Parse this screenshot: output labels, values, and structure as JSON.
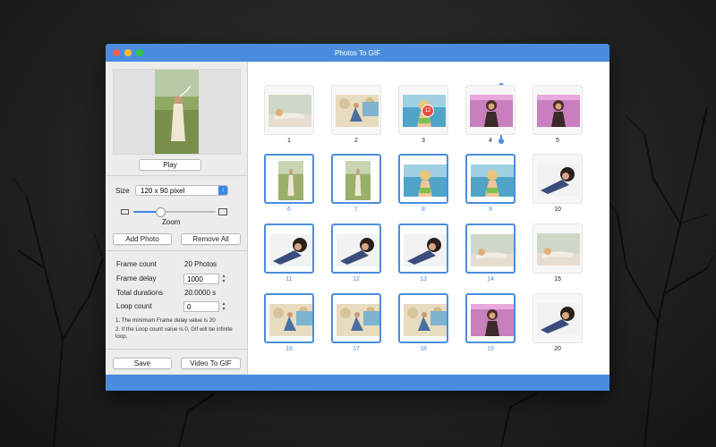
{
  "window": {
    "title": "Photos To GIF"
  },
  "sidebar": {
    "play_label": "Play",
    "size_label": "Size",
    "size_value": "120 x 90 pixel",
    "zoom_label": "Zoom",
    "zoom_level": 0.32,
    "add_label": "Add Photo",
    "remove_label": "Remove All",
    "frame_count_label": "Frame count",
    "frame_count_value": "20 Photos",
    "frame_delay_label": "Frame delay",
    "frame_delay_value": "1000",
    "total_label": "Total durations",
    "total_value": "20.0000 s",
    "loop_label": "Loop count",
    "loop_value": "0",
    "note1": "1. The minimum Frame delay value is 20",
    "note2": "2. If the Loop count value is 0, Gif will be infinite loop.",
    "save_label": "Save",
    "video_label": "Video To GIF"
  },
  "drag_badge": "12",
  "photos": [
    {
      "num": "1",
      "scene": "beach-lying",
      "selected": false
    },
    {
      "num": "2",
      "scene": "floral-sitting",
      "selected": false
    },
    {
      "num": "3",
      "scene": "sea-blonde",
      "selected": false
    },
    {
      "num": "4",
      "scene": "purple-brunette",
      "selected": false
    },
    {
      "num": "5",
      "scene": "purple-brunette",
      "selected": false
    },
    {
      "num": "6",
      "scene": "field-standing",
      "selected": true
    },
    {
      "num": "7",
      "scene": "field-standing",
      "selected": true
    },
    {
      "num": "8",
      "scene": "sea-blonde",
      "selected": true
    },
    {
      "num": "9",
      "scene": "sea-blonde",
      "selected": true
    },
    {
      "num": "10",
      "scene": "dark-lying",
      "selected": false
    },
    {
      "num": "11",
      "scene": "dark-lying",
      "selected": true
    },
    {
      "num": "12",
      "scene": "dark-lying",
      "selected": true
    },
    {
      "num": "13",
      "scene": "dark-lying",
      "selected": true
    },
    {
      "num": "14",
      "scene": "beach-lying",
      "selected": true
    },
    {
      "num": "15",
      "scene": "beach-lying",
      "selected": false
    },
    {
      "num": "16",
      "scene": "floral-sitting",
      "selected": true
    },
    {
      "num": "17",
      "scene": "floral-sitting",
      "selected": true
    },
    {
      "num": "18",
      "scene": "floral-sitting",
      "selected": true
    },
    {
      "num": "19",
      "scene": "purple-brunette",
      "selected": true
    },
    {
      "num": "20",
      "scene": "dark-lying",
      "selected": false
    }
  ],
  "colors": {
    "accent": "#4a8de0",
    "bar": "#4a8de0"
  }
}
